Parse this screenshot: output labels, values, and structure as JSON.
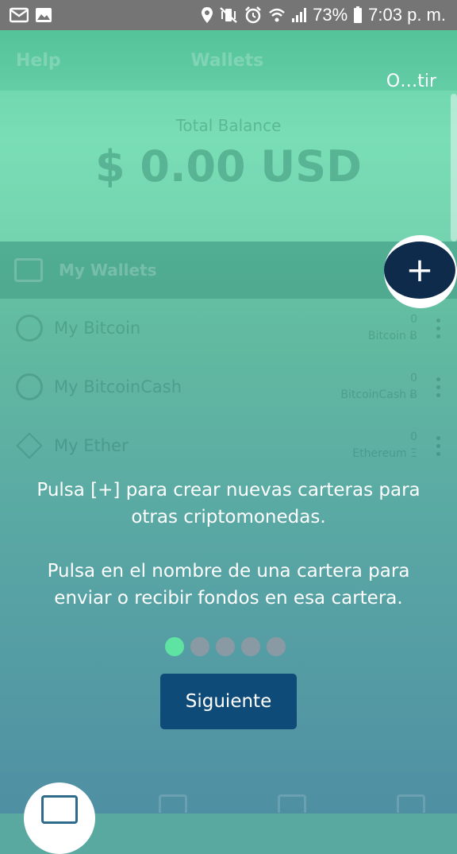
{
  "status_bar": {
    "battery": "73%",
    "time": "7:03 p. m.",
    "icons_left": [
      "mail-icon",
      "image-icon"
    ],
    "icons_right": [
      "location-icon",
      "vibrate-mute-icon",
      "alarm-icon",
      "wifi-icon",
      "signal-icon",
      "battery-icon"
    ]
  },
  "app_header": {
    "help_label": "Help",
    "title": "Wallets",
    "skip_label": "O…tir"
  },
  "balance": {
    "label": "Total Balance",
    "value": "$ 0.00 USD"
  },
  "wallets_section": {
    "title": "My Wallets",
    "items": [
      {
        "name": "My Bitcoin",
        "amount": "0",
        "unit": "Bitcoin Ƀ"
      },
      {
        "name": "My BitcoinCash",
        "amount": "0",
        "unit": "BitcoinCash Ƀ"
      },
      {
        "name": "My Ether",
        "amount": "0",
        "unit": "Ethereum Ξ"
      }
    ]
  },
  "add_button": {
    "label": "+"
  },
  "tutorial": {
    "paragraph_1": "Pulsa [+] para crear nuevas carteras para otras criptomonedas.",
    "paragraph_2": "Pulsa en el nombre de una cartera para enviar o recibir fondos en esa cartera.",
    "current_page": 1,
    "total_pages": 5,
    "next_label": "Siguiente"
  },
  "colors": {
    "accent_dot": "#5fe3a2",
    "button": "#0f4b78",
    "plus_button": "#0f2b4c"
  }
}
